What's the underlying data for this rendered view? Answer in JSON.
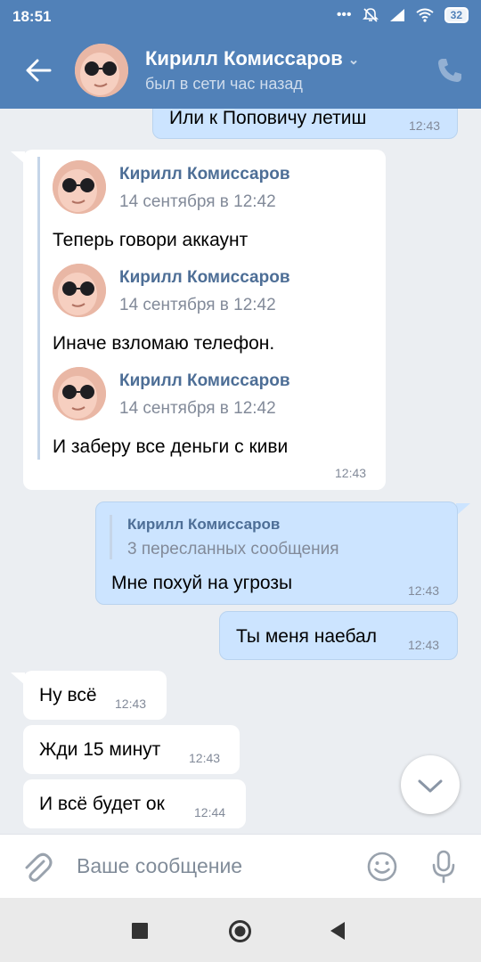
{
  "status_bar": {
    "time": "18:51",
    "battery": "32"
  },
  "header": {
    "name": "Кирилл Комиссаров",
    "status": "был в сети час назад"
  },
  "messages": {
    "m0": {
      "text": "Или к Поповичу летиш",
      "time": "12:43"
    },
    "m1": {
      "forwarded": [
        {
          "author": "Кирилл Комиссаров",
          "date": "14 сентября в 12:42",
          "text": "Теперь говори аккаунт"
        },
        {
          "author": "Кирилл Комиссаров",
          "date": "14 сентября в 12:42",
          "text": "Иначе взломаю телефон."
        },
        {
          "author": "Кирилл Комиссаров",
          "date": "14 сентября в 12:42",
          "text": "И заберу все деньги с киви"
        }
      ],
      "time": "12:43"
    },
    "m2": {
      "fwd_author": "Кирилл Комиссаров",
      "fwd_count": "3 пересланных сообщения",
      "text": "Мне похуй на угрозы",
      "time": "12:43"
    },
    "m3": {
      "text": "Ты меня наебал",
      "time": "12:43"
    },
    "m4": {
      "text": "Ну всё",
      "time": "12:43"
    },
    "m5": {
      "text": "Жди 15 минут",
      "time": "12:43"
    },
    "m6": {
      "text": "И всё будет ок",
      "time": "12:44"
    }
  },
  "composer": {
    "placeholder": "Ваше сообщение"
  },
  "icons": {
    "back": "arrow-left-icon",
    "phone": "phone-icon",
    "attach": "paperclip-icon",
    "emoji": "smile-icon",
    "mic": "microphone-icon",
    "scroll": "chevron-down-icon"
  },
  "colors": {
    "header": "#5181b8",
    "incoming": "#ffffff",
    "outgoing": "#cce4ff",
    "background": "#ebeef2",
    "link": "#4d6e96"
  }
}
